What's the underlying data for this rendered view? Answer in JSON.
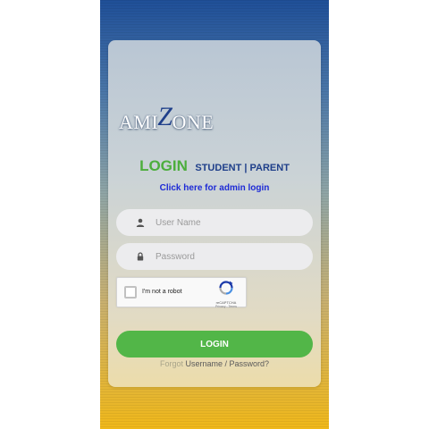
{
  "brand": {
    "logo_left": "AMI",
    "logo_z": "Z",
    "logo_right": "ONE"
  },
  "heading": {
    "login": "LOGIN",
    "roles": "STUDENT | PARENT"
  },
  "admin_link": "Click here for admin login",
  "form": {
    "username": {
      "placeholder": "User Name",
      "value": "",
      "icon": "user-icon"
    },
    "password": {
      "placeholder": "Password",
      "value": "",
      "icon": "lock-icon"
    }
  },
  "captcha": {
    "label": "I'm not a robot",
    "brand": "reCAPTCHA",
    "terms": "Privacy - Terms",
    "checked": false
  },
  "login_button": "LOGIN",
  "forgot": {
    "prefix": "Forgot",
    "link": "Username / Password?"
  },
  "colors": {
    "accent_green": "#52b648",
    "brand_blue": "#1f3f8a",
    "link_blue": "#1d2ad6",
    "gradient_top": "#1f4f98",
    "gradient_bottom": "#f0b81a"
  }
}
